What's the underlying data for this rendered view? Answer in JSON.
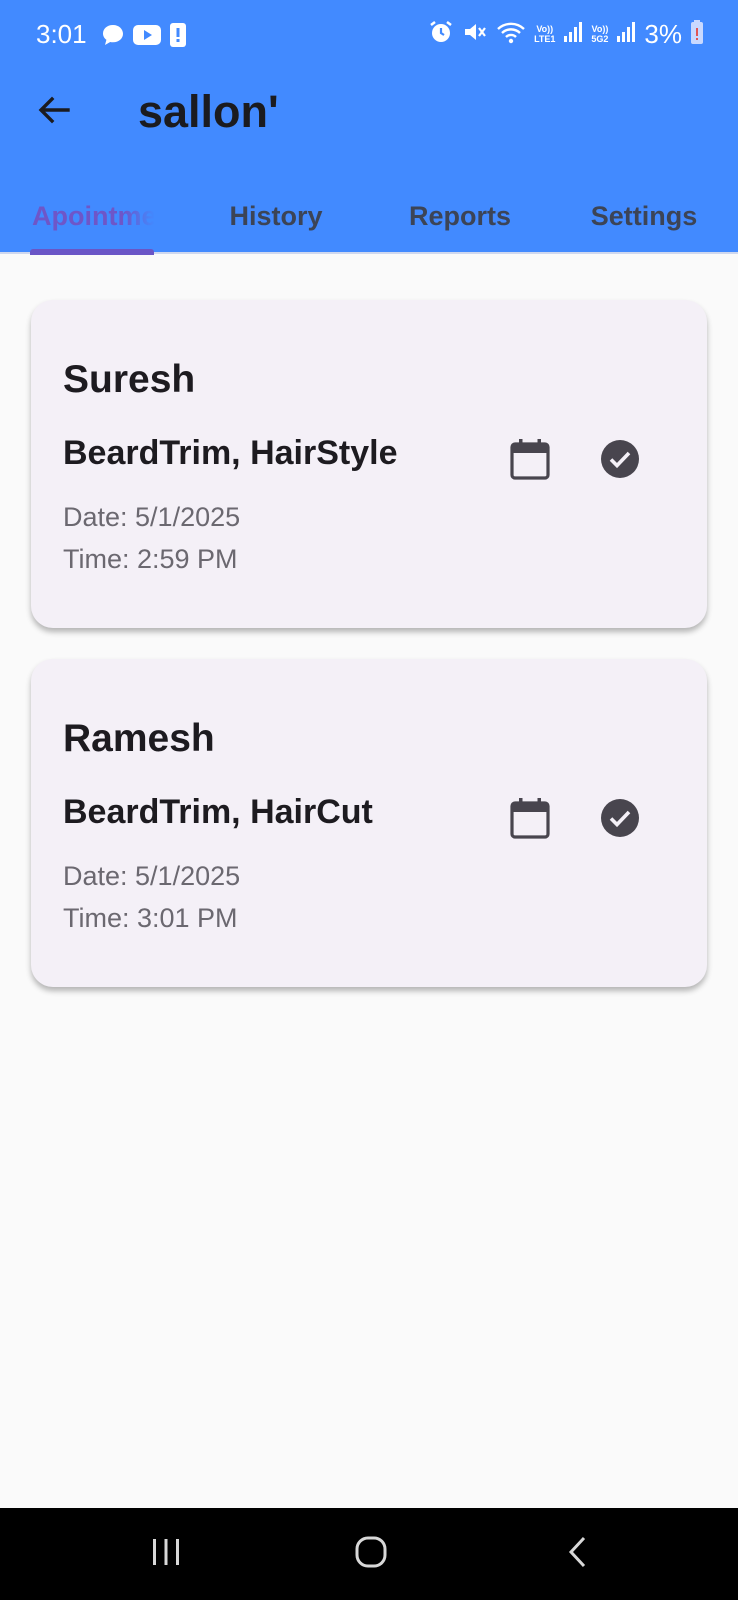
{
  "status_bar": {
    "time": "3:01",
    "battery": "3%",
    "left_icons": [
      "chat-bubble-icon",
      "youtube-icon",
      "alert-icon"
    ],
    "right_icons": [
      "alarm-icon",
      "mute-icon",
      "wifi-icon",
      "signal-lte1-icon",
      "signal-5g2-icon",
      "battery-low-icon"
    ],
    "sim1_label_top": "Vo))",
    "sim1_label_bottom": "LTE1",
    "sim2_label_top": "Vo))",
    "sim2_label_bottom": "5G2"
  },
  "header": {
    "title": "sallon'",
    "back_icon": "arrow-left-icon",
    "background_color": "#428aff"
  },
  "tabs": [
    {
      "label": "Apointments",
      "active": true
    },
    {
      "label": "History",
      "active": false
    },
    {
      "label": "Reports",
      "active": false
    },
    {
      "label": "Settings",
      "active": false
    }
  ],
  "appointments": [
    {
      "name": "Suresh",
      "services": "BeardTrim, HairStyle",
      "date": "Date: 5/1/2025",
      "time": "Time: 2:59 PM"
    },
    {
      "name": "Ramesh",
      "services": "BeardTrim, HairCut",
      "date": "Date: 5/1/2025",
      "time": "Time: 3:01 PM"
    }
  ],
  "nav_bar": {
    "buttons": [
      "recents-icon",
      "home-icon",
      "back-icon"
    ]
  },
  "colors": {
    "accent": "#6e56c8",
    "card_bg": "#f4f0f7",
    "page_bg": "#fafafa"
  }
}
